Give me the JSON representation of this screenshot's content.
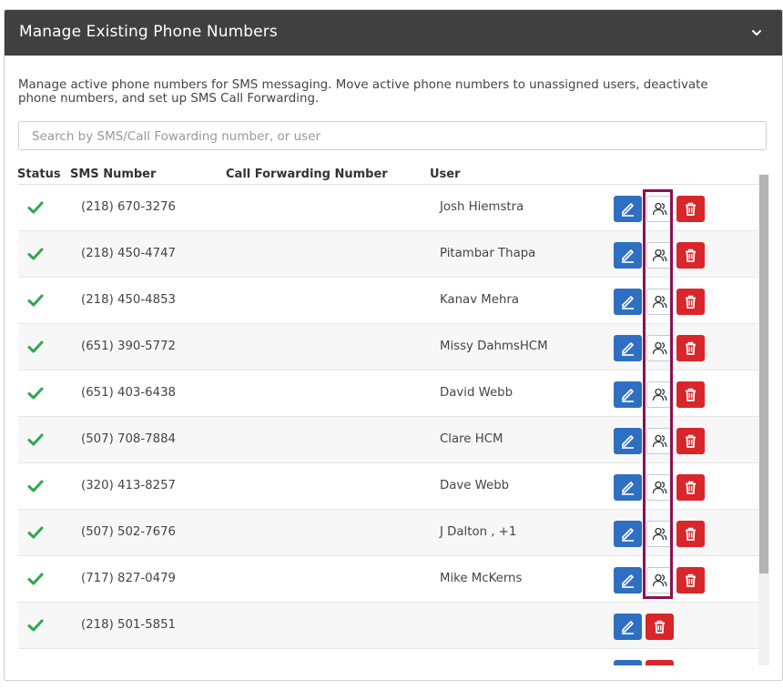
{
  "panel": {
    "title": "Manage Existing Phone Numbers",
    "description": "Manage active phone numbers for SMS messaging. Move active phone numbers to unassigned users, deactivate phone numbers, and set up SMS Call Forwarding.",
    "search_placeholder": "Search by SMS/Call Fowarding number, or user"
  },
  "table": {
    "columns": [
      "Status",
      "SMS Number",
      "Call Forwarding Number",
      "User"
    ],
    "rows": [
      {
        "status": "active",
        "sms": "(218) 670-3276",
        "forwarding": "",
        "user": "Josh Hiemstra"
      },
      {
        "status": "active",
        "sms": "(218) 450-4747",
        "forwarding": "",
        "user": "Pitambar Thapa"
      },
      {
        "status": "active",
        "sms": "(218) 450-4853",
        "forwarding": "",
        "user": "Kanav Mehra"
      },
      {
        "status": "active",
        "sms": "(651) 390-5772",
        "forwarding": "",
        "user": "Missy DahmsHCM"
      },
      {
        "status": "active",
        "sms": "(651) 403-6438",
        "forwarding": "",
        "user": "David Webb"
      },
      {
        "status": "active",
        "sms": "(507) 708-7884",
        "forwarding": "",
        "user": "Clare HCM"
      },
      {
        "status": "active",
        "sms": "(320) 413-8257",
        "forwarding": "",
        "user": "Dave Webb"
      },
      {
        "status": "active",
        "sms": "(507) 502-7676",
        "forwarding": "",
        "user": "J Dalton , +1"
      },
      {
        "status": "active",
        "sms": "(717) 827-0479",
        "forwarding": "",
        "user": "Mike McKerns"
      },
      {
        "status": "active",
        "sms": "(218) 501-5851",
        "forwarding": "",
        "user": ""
      }
    ]
  },
  "icons": {
    "status": "check-icon",
    "edit": "pencil-icon",
    "assign": "users-icon",
    "delete": "trash-icon",
    "collapse": "chevron-down-icon"
  },
  "colors": {
    "header_bg": "#404040",
    "edit": "#2e6fc2",
    "delete": "#d9262a",
    "check": "#2fa84f",
    "highlight": "#8a1252"
  }
}
